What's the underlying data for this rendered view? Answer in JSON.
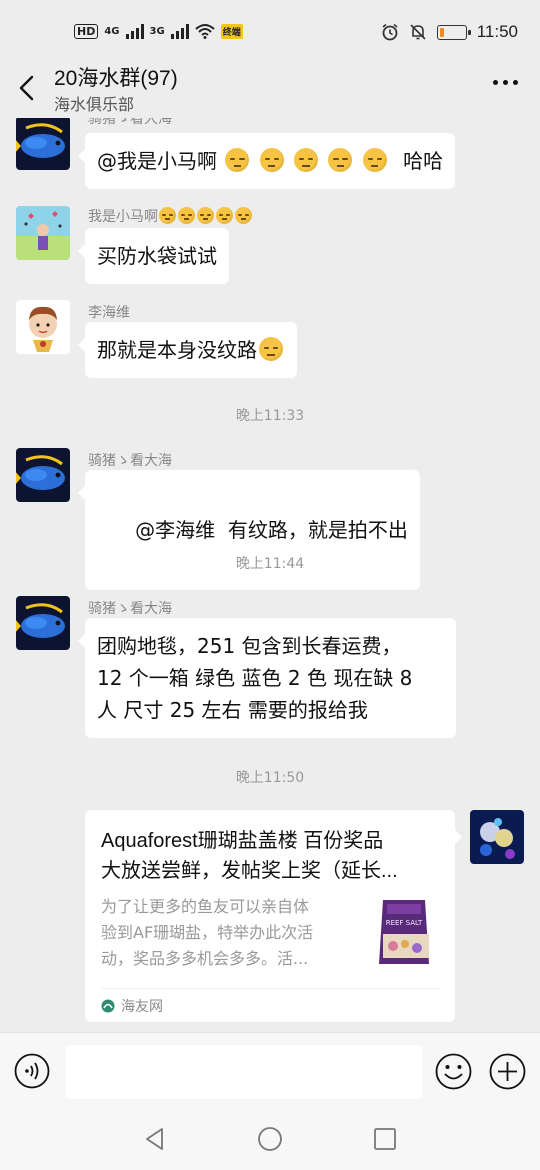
{
  "status_bar": {
    "hd": "HD",
    "net1": "4G",
    "net2": "3G",
    "pay_badge": "终端",
    "time": "11:50",
    "battery_percent": 15,
    "icons": [
      "signal-icon",
      "wifi-icon",
      "alarm-icon",
      "mute-icon",
      "battery-icon"
    ]
  },
  "header": {
    "title": "20海水群(97)",
    "subtitle": "海水俱乐部"
  },
  "messages": [
    {
      "sender": "骑猪ゝ看大海",
      "text": "@我是小马啊",
      "emoji_count": 5,
      "suffix": "哈哈"
    },
    {
      "sender": "我是小马啊",
      "sender_emoji_count": 5,
      "text": "买防水袋试试"
    },
    {
      "sender": "李海维",
      "text": "那就是本身没纹路",
      "emoji_count": 1
    },
    {
      "sender": "骑猪ゝ看大海",
      "text": "@李海维  有纹路，就是拍不出"
    },
    {
      "sender": "骑猪ゝ看大海",
      "lines": [
        "团购地毯，251 包含到长春运费，",
        "12 个一箱 绿色 蓝色 2 色 现在缺 8",
        "人 尺寸 25 左右 需要的报给我"
      ]
    }
  ],
  "timestamps": [
    "晚上11:33",
    "晚上11:44",
    "晚上11:50"
  ],
  "link_card": {
    "title_lines": [
      "Aquaforest珊瑚盐盖楼 百份奖品",
      "大放送尝鲜，发帖奖上奖（延长..."
    ],
    "desc_lines": [
      "为了让更多的鱼友可以亲自体",
      "验到AF珊瑚盐，特举办此次活",
      "动，奖品多多机会多多。活..."
    ],
    "source": "海友网",
    "thumb_label": "REEF SALT"
  },
  "input_bar": {
    "placeholder": ""
  },
  "colors": {
    "background": "#ededed",
    "bubble": "#ffffff",
    "accent": "#f6c342"
  }
}
